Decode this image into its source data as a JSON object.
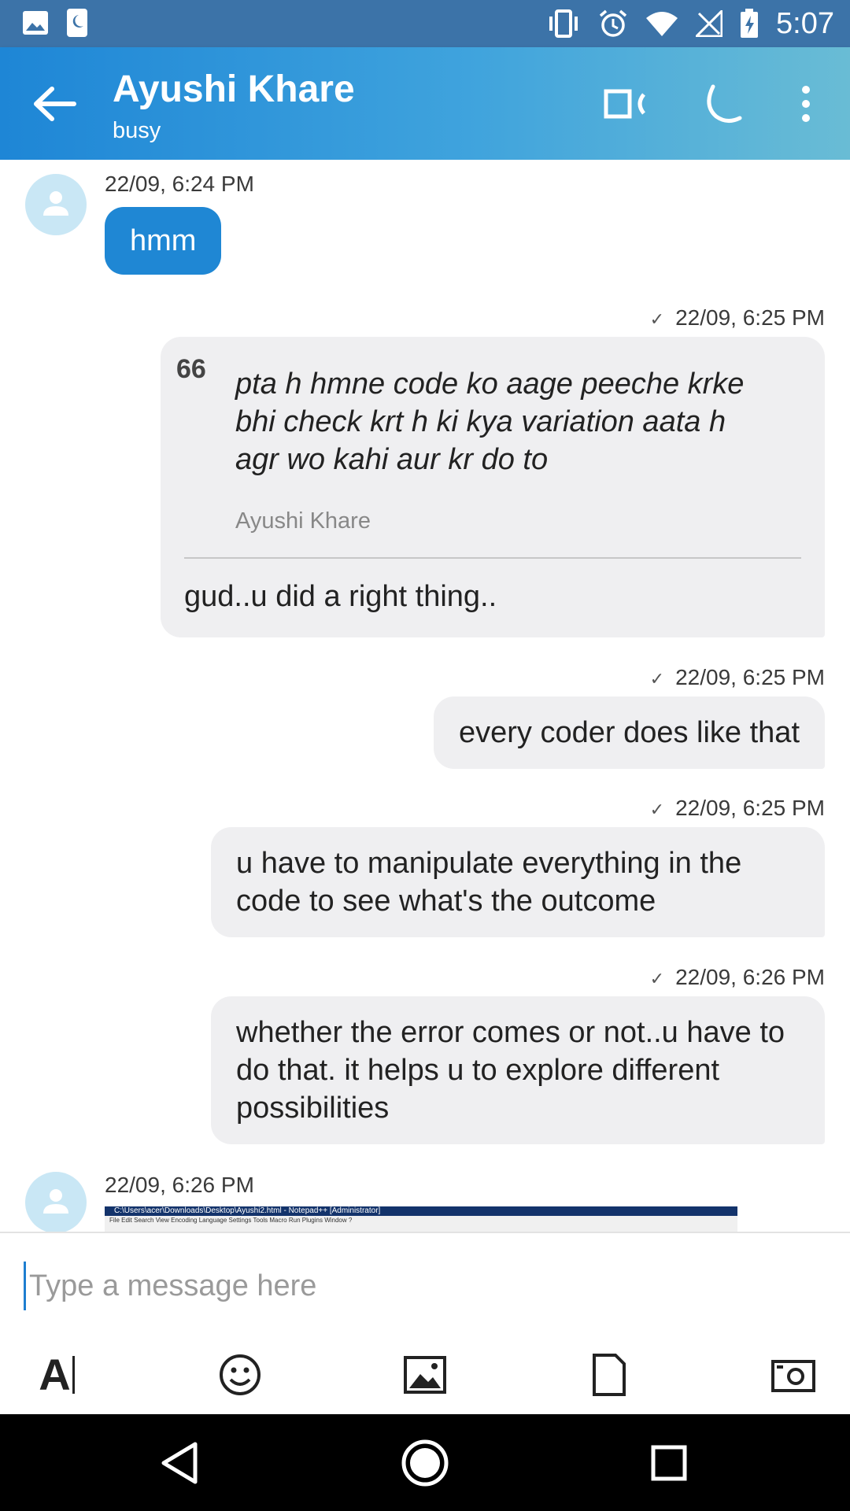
{
  "status_bar": {
    "time": "5:07",
    "icons": [
      "image-icon",
      "do-not-disturb-icon",
      "vibrate-icon",
      "alarm-icon",
      "wifi-icon",
      "no-sim-icon",
      "battery-charging-icon"
    ]
  },
  "header": {
    "contact_name": "Ayushi Khare",
    "contact_status": "busy",
    "icons": [
      "back-arrow-icon",
      "video-call-icon",
      "voice-call-icon",
      "more-vert-icon"
    ]
  },
  "messages": [
    {
      "direction": "incoming",
      "timestamp": "22/09, 6:24 PM",
      "text": "hmm"
    },
    {
      "direction": "outgoing",
      "timestamp": "22/09, 6:25 PM",
      "status": "sent",
      "quote": {
        "mark": "66",
        "text": "pta h hmne code ko aage peeche krke bhi check krt h ki kya variation aata h agr wo kahi aur kr do to",
        "author": "Ayushi Khare"
      },
      "text": "gud..u did a right thing.."
    },
    {
      "direction": "outgoing",
      "timestamp": "22/09, 6:25 PM",
      "status": "sent",
      "text": "every coder does like that"
    },
    {
      "direction": "outgoing",
      "timestamp": "22/09, 6:25 PM",
      "status": "sent",
      "text": "u have to manipulate everything in the code to see what's the outcome"
    },
    {
      "direction": "outgoing",
      "timestamp": "22/09, 6:26 PM",
      "status": "sent",
      "text": "whether the error comes or not..u have to do that. it helps u to explore different possibilities"
    },
    {
      "direction": "incoming",
      "timestamp": "22/09, 6:26 PM",
      "image": {
        "title": "C:\\Users\\acer\\Downloads\\Desktop\\Ayushi2.html - Notepad++ [Administrator]",
        "menu": "File   Edit   Search   View   Encoding   Language   Settings   Tools   Macro   Run   Plugins   Window   ?"
      }
    }
  ],
  "composer": {
    "placeholder": "Type a message here",
    "value": "",
    "tools": [
      "text-format-icon",
      "emoji-icon",
      "image-attach-icon",
      "file-attach-icon",
      "camera-icon"
    ],
    "text_format_label": "A"
  },
  "nav_bar": {
    "icons": [
      "back-icon",
      "home-icon",
      "recents-icon"
    ]
  },
  "colors": {
    "status_bar": "#3c73a8",
    "header_start": "#1e86d6",
    "header_end": "#69bcd5",
    "incoming_bubble": "#1f87d4",
    "outgoing_bubble": "#efeff1",
    "avatar": "#c9e7f5"
  }
}
